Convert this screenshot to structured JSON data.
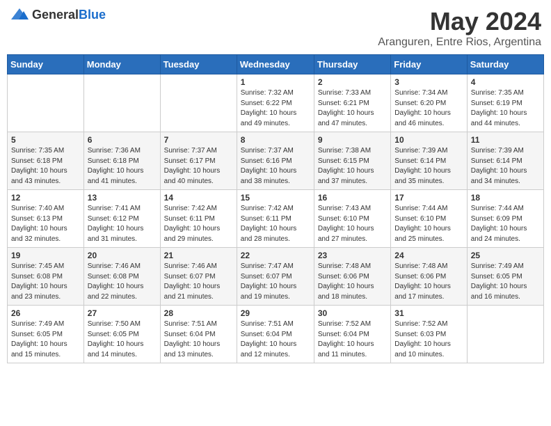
{
  "header": {
    "logo_general": "General",
    "logo_blue": "Blue",
    "month_title": "May 2024",
    "location": "Aranguren, Entre Rios, Argentina"
  },
  "days_of_week": [
    "Sunday",
    "Monday",
    "Tuesday",
    "Wednesday",
    "Thursday",
    "Friday",
    "Saturday"
  ],
  "weeks": [
    {
      "row_class": "row-1",
      "days": [
        {
          "num": "",
          "info": ""
        },
        {
          "num": "",
          "info": ""
        },
        {
          "num": "",
          "info": ""
        },
        {
          "num": "1",
          "info": "Sunrise: 7:32 AM\nSunset: 6:22 PM\nDaylight: 10 hours\nand 49 minutes."
        },
        {
          "num": "2",
          "info": "Sunrise: 7:33 AM\nSunset: 6:21 PM\nDaylight: 10 hours\nand 47 minutes."
        },
        {
          "num": "3",
          "info": "Sunrise: 7:34 AM\nSunset: 6:20 PM\nDaylight: 10 hours\nand 46 minutes."
        },
        {
          "num": "4",
          "info": "Sunrise: 7:35 AM\nSunset: 6:19 PM\nDaylight: 10 hours\nand 44 minutes."
        }
      ]
    },
    {
      "row_class": "row-2",
      "days": [
        {
          "num": "5",
          "info": "Sunrise: 7:35 AM\nSunset: 6:18 PM\nDaylight: 10 hours\nand 43 minutes."
        },
        {
          "num": "6",
          "info": "Sunrise: 7:36 AM\nSunset: 6:18 PM\nDaylight: 10 hours\nand 41 minutes."
        },
        {
          "num": "7",
          "info": "Sunrise: 7:37 AM\nSunset: 6:17 PM\nDaylight: 10 hours\nand 40 minutes."
        },
        {
          "num": "8",
          "info": "Sunrise: 7:37 AM\nSunset: 6:16 PM\nDaylight: 10 hours\nand 38 minutes."
        },
        {
          "num": "9",
          "info": "Sunrise: 7:38 AM\nSunset: 6:15 PM\nDaylight: 10 hours\nand 37 minutes."
        },
        {
          "num": "10",
          "info": "Sunrise: 7:39 AM\nSunset: 6:14 PM\nDaylight: 10 hours\nand 35 minutes."
        },
        {
          "num": "11",
          "info": "Sunrise: 7:39 AM\nSunset: 6:14 PM\nDaylight: 10 hours\nand 34 minutes."
        }
      ]
    },
    {
      "row_class": "row-3",
      "days": [
        {
          "num": "12",
          "info": "Sunrise: 7:40 AM\nSunset: 6:13 PM\nDaylight: 10 hours\nand 32 minutes."
        },
        {
          "num": "13",
          "info": "Sunrise: 7:41 AM\nSunset: 6:12 PM\nDaylight: 10 hours\nand 31 minutes."
        },
        {
          "num": "14",
          "info": "Sunrise: 7:42 AM\nSunset: 6:11 PM\nDaylight: 10 hours\nand 29 minutes."
        },
        {
          "num": "15",
          "info": "Sunrise: 7:42 AM\nSunset: 6:11 PM\nDaylight: 10 hours\nand 28 minutes."
        },
        {
          "num": "16",
          "info": "Sunrise: 7:43 AM\nSunset: 6:10 PM\nDaylight: 10 hours\nand 27 minutes."
        },
        {
          "num": "17",
          "info": "Sunrise: 7:44 AM\nSunset: 6:10 PM\nDaylight: 10 hours\nand 25 minutes."
        },
        {
          "num": "18",
          "info": "Sunrise: 7:44 AM\nSunset: 6:09 PM\nDaylight: 10 hours\nand 24 minutes."
        }
      ]
    },
    {
      "row_class": "row-4",
      "days": [
        {
          "num": "19",
          "info": "Sunrise: 7:45 AM\nSunset: 6:08 PM\nDaylight: 10 hours\nand 23 minutes."
        },
        {
          "num": "20",
          "info": "Sunrise: 7:46 AM\nSunset: 6:08 PM\nDaylight: 10 hours\nand 22 minutes."
        },
        {
          "num": "21",
          "info": "Sunrise: 7:46 AM\nSunset: 6:07 PM\nDaylight: 10 hours\nand 21 minutes."
        },
        {
          "num": "22",
          "info": "Sunrise: 7:47 AM\nSunset: 6:07 PM\nDaylight: 10 hours\nand 19 minutes."
        },
        {
          "num": "23",
          "info": "Sunrise: 7:48 AM\nSunset: 6:06 PM\nDaylight: 10 hours\nand 18 minutes."
        },
        {
          "num": "24",
          "info": "Sunrise: 7:48 AM\nSunset: 6:06 PM\nDaylight: 10 hours\nand 17 minutes."
        },
        {
          "num": "25",
          "info": "Sunrise: 7:49 AM\nSunset: 6:05 PM\nDaylight: 10 hours\nand 16 minutes."
        }
      ]
    },
    {
      "row_class": "row-5",
      "days": [
        {
          "num": "26",
          "info": "Sunrise: 7:49 AM\nSunset: 6:05 PM\nDaylight: 10 hours\nand 15 minutes."
        },
        {
          "num": "27",
          "info": "Sunrise: 7:50 AM\nSunset: 6:05 PM\nDaylight: 10 hours\nand 14 minutes."
        },
        {
          "num": "28",
          "info": "Sunrise: 7:51 AM\nSunset: 6:04 PM\nDaylight: 10 hours\nand 13 minutes."
        },
        {
          "num": "29",
          "info": "Sunrise: 7:51 AM\nSunset: 6:04 PM\nDaylight: 10 hours\nand 12 minutes."
        },
        {
          "num": "30",
          "info": "Sunrise: 7:52 AM\nSunset: 6:04 PM\nDaylight: 10 hours\nand 11 minutes."
        },
        {
          "num": "31",
          "info": "Sunrise: 7:52 AM\nSunset: 6:03 PM\nDaylight: 10 hours\nand 10 minutes."
        },
        {
          "num": "",
          "info": ""
        }
      ]
    }
  ]
}
